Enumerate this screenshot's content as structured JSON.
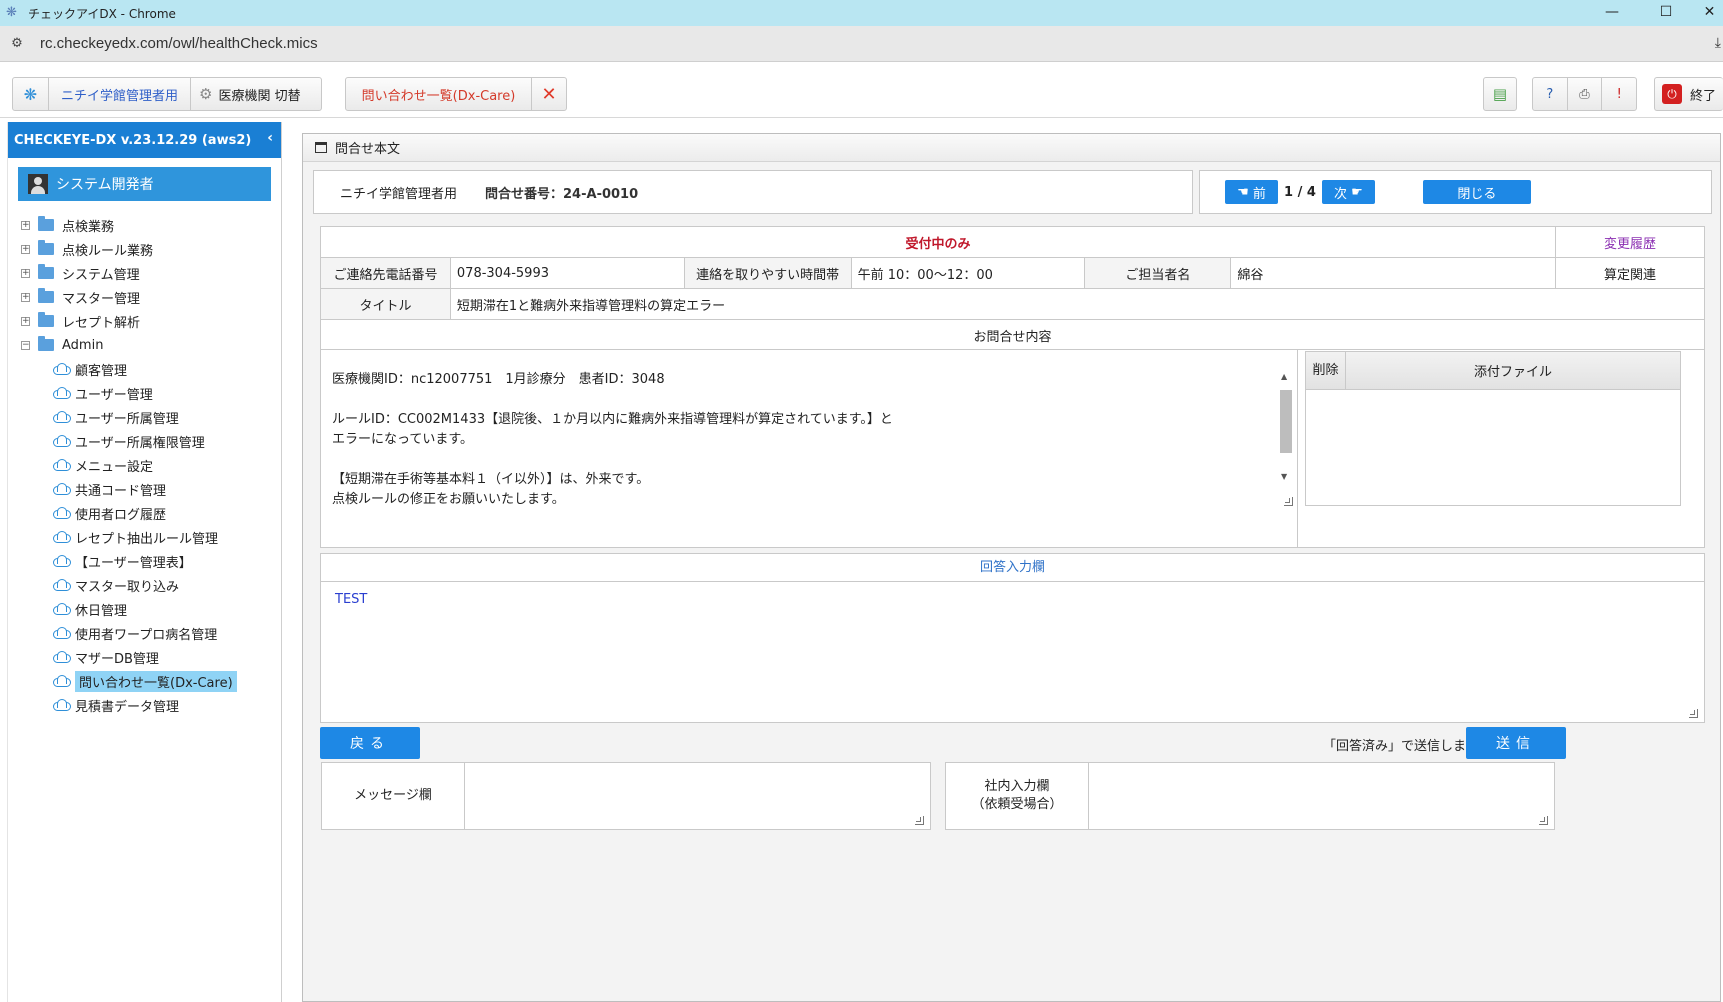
{
  "browser": {
    "title": "チェックアイDX - Chrome",
    "url": "rc.checkeyedx.com/owl/healthCheck.mics"
  },
  "toolbar": {
    "user_label": "ニチイ学館管理者用",
    "switch_label": "医療機関 切替",
    "active_tab_label": "問い合わせ一覧(Dx-Care)",
    "exit_label": "終了"
  },
  "sidebar": {
    "version": "CHECKEYE-DX v.23.12.29 (aws2)",
    "user_name": "システム開発者",
    "folders": [
      "点検業務",
      "点検ルール業務",
      "システム管理",
      "マスター管理",
      "レセプト解析",
      "Admin"
    ],
    "admin_items": [
      "顧客管理",
      "ユーザー管理",
      "ユーザー所属管理",
      "ユーザー所属権限管理",
      "メニュー設定",
      "共通コード管理",
      "使用者ログ履歴",
      "レセプト抽出ルール管理",
      "【ユーザー管理表】",
      "マスター取り込み",
      "休日管理",
      "使用者ワープロ病名管理",
      "マザーDB管理",
      "問い合わせ一覧(Dx-Care)",
      "見積書データ管理"
    ],
    "selected_item": "問い合わせ一覧(Dx-Care)"
  },
  "panel": {
    "title": "問合せ本文",
    "org_name": "ニチイ学館管理者用",
    "inquiry_no": "問合せ番号：24-A-0010",
    "prev_label": "前",
    "next_label": "次",
    "page_indicator": "1 / 4",
    "close_label": "閉じる"
  },
  "form": {
    "status": "受付中のみ",
    "history_link": "変更履歴",
    "phone_label": "ご連絡先電話番号",
    "phone_value": "078-304-5993",
    "time_label": "連絡を取りやすい時間帯",
    "time_value": "午前 10：00～12：00",
    "person_label": "ご担当者名",
    "person_value": "綿谷",
    "category_value": "算定関連",
    "title_label": "タイトル",
    "title_value": "短期滞在1と難病外来指導管理料の算定エラー",
    "content_label": "お問合せ内容"
  },
  "inquiry": {
    "lines": [
      "医療機関ID：nc12007751　1月診療分　患者ID：3048",
      "",
      "ルールID：CC002M1433【退院後、１か月以内に難病外来指導管理料が算定されています。】と",
      "エラーになっています。",
      "",
      "【短期滞在手術等基本料１（イ以外）】は、外来です。",
      "点検ルールの修正をお願いいたします。"
    ]
  },
  "attachments": {
    "delete_header": "削除",
    "file_header": "添付ファイル"
  },
  "reply": {
    "header": "回答入力欄",
    "value": "TEST"
  },
  "actions": {
    "back_label": "戻る",
    "notice": "「回答済み」で送信します。",
    "send_label": "送信"
  },
  "bottom": {
    "message_label": "メッセージ欄",
    "internal_label_1": "社内入力欄",
    "internal_label_2": "（依頼受場合）"
  },
  "colors": {
    "accent_blue": "#1e88e5",
    "status_red": "#c0182b",
    "link_purple": "#8b2fb2"
  }
}
